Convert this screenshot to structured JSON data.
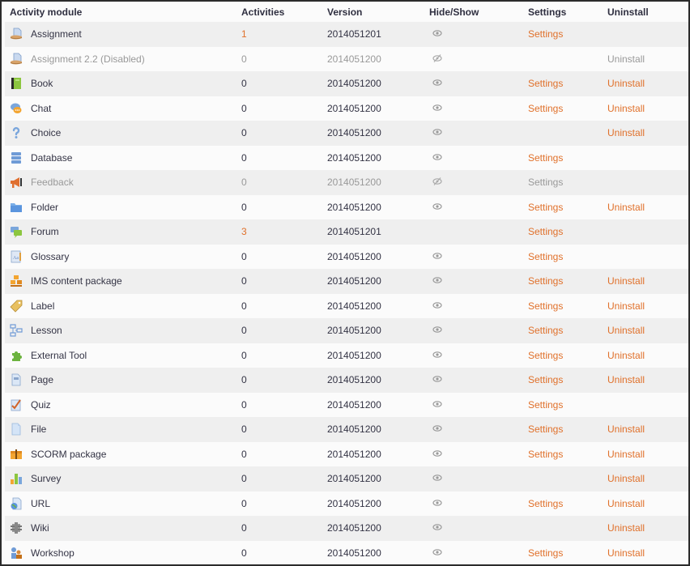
{
  "table": {
    "headers": {
      "module": "Activity module",
      "activities": "Activities",
      "version": "Version",
      "hideshow": "Hide/Show",
      "settings": "Settings",
      "uninstall": "Uninstall"
    },
    "accent_color": "#e0702a",
    "rows": [
      {
        "name": "Assignment",
        "icon": "assignment-icon",
        "activities": "1",
        "version": "2014051201",
        "visibility": "shown",
        "settings": "Settings",
        "uninstall": "",
        "disabled": false
      },
      {
        "name": "Assignment 2.2 (Disabled)",
        "icon": "assignment-icon",
        "activities": "0",
        "version": "2014051200",
        "visibility": "hidden",
        "settings": "",
        "uninstall": "Uninstall",
        "disabled": true
      },
      {
        "name": "Book",
        "icon": "book-icon",
        "activities": "0",
        "version": "2014051200",
        "visibility": "shown",
        "settings": "Settings",
        "uninstall": "Uninstall",
        "disabled": false
      },
      {
        "name": "Chat",
        "icon": "chat-icon",
        "activities": "0",
        "version": "2014051200",
        "visibility": "shown",
        "settings": "Settings",
        "uninstall": "Uninstall",
        "disabled": false
      },
      {
        "name": "Choice",
        "icon": "choice-icon",
        "activities": "0",
        "version": "2014051200",
        "visibility": "shown",
        "settings": "",
        "uninstall": "Uninstall",
        "disabled": false
      },
      {
        "name": "Database",
        "icon": "database-icon",
        "activities": "0",
        "version": "2014051200",
        "visibility": "shown",
        "settings": "Settings",
        "uninstall": "",
        "disabled": false
      },
      {
        "name": "Feedback",
        "icon": "feedback-icon",
        "activities": "0",
        "version": "2014051200",
        "visibility": "hidden",
        "settings": "Settings",
        "uninstall": "",
        "disabled": true
      },
      {
        "name": "Folder",
        "icon": "folder-icon",
        "activities": "0",
        "version": "2014051200",
        "visibility": "shown",
        "settings": "Settings",
        "uninstall": "Uninstall",
        "disabled": false
      },
      {
        "name": "Forum",
        "icon": "forum-icon",
        "activities": "3",
        "version": "2014051201",
        "visibility": "none",
        "settings": "Settings",
        "uninstall": "",
        "disabled": false
      },
      {
        "name": "Glossary",
        "icon": "glossary-icon",
        "activities": "0",
        "version": "2014051200",
        "visibility": "shown",
        "settings": "Settings",
        "uninstall": "",
        "disabled": false
      },
      {
        "name": "IMS content package",
        "icon": "ims-package-icon",
        "activities": "0",
        "version": "2014051200",
        "visibility": "shown",
        "settings": "Settings",
        "uninstall": "Uninstall",
        "disabled": false
      },
      {
        "name": "Label",
        "icon": "label-icon",
        "activities": "0",
        "version": "2014051200",
        "visibility": "shown",
        "settings": "Settings",
        "uninstall": "Uninstall",
        "disabled": false
      },
      {
        "name": "Lesson",
        "icon": "lesson-icon",
        "activities": "0",
        "version": "2014051200",
        "visibility": "shown",
        "settings": "Settings",
        "uninstall": "Uninstall",
        "disabled": false
      },
      {
        "name": "External Tool",
        "icon": "external-tool-icon",
        "activities": "0",
        "version": "2014051200",
        "visibility": "shown",
        "settings": "Settings",
        "uninstall": "Uninstall",
        "disabled": false
      },
      {
        "name": "Page",
        "icon": "page-icon",
        "activities": "0",
        "version": "2014051200",
        "visibility": "shown",
        "settings": "Settings",
        "uninstall": "Uninstall",
        "disabled": false
      },
      {
        "name": "Quiz",
        "icon": "quiz-icon",
        "activities": "0",
        "version": "2014051200",
        "visibility": "shown",
        "settings": "Settings",
        "uninstall": "",
        "disabled": false
      },
      {
        "name": "File",
        "icon": "file-icon",
        "activities": "0",
        "version": "2014051200",
        "visibility": "shown",
        "settings": "Settings",
        "uninstall": "Uninstall",
        "disabled": false
      },
      {
        "name": "SCORM package",
        "icon": "scorm-icon",
        "activities": "0",
        "version": "2014051200",
        "visibility": "shown",
        "settings": "Settings",
        "uninstall": "Uninstall",
        "disabled": false
      },
      {
        "name": "Survey",
        "icon": "survey-icon",
        "activities": "0",
        "version": "2014051200",
        "visibility": "shown",
        "settings": "",
        "uninstall": "Uninstall",
        "disabled": false
      },
      {
        "name": "URL",
        "icon": "url-icon",
        "activities": "0",
        "version": "2014051200",
        "visibility": "shown",
        "settings": "Settings",
        "uninstall": "Uninstall",
        "disabled": false
      },
      {
        "name": "Wiki",
        "icon": "wiki-icon",
        "activities": "0",
        "version": "2014051200",
        "visibility": "shown",
        "settings": "",
        "uninstall": "Uninstall",
        "disabled": false
      },
      {
        "name": "Workshop",
        "icon": "workshop-icon",
        "activities": "0",
        "version": "2014051200",
        "visibility": "shown",
        "settings": "Settings",
        "uninstall": "Uninstall",
        "disabled": false
      }
    ]
  }
}
